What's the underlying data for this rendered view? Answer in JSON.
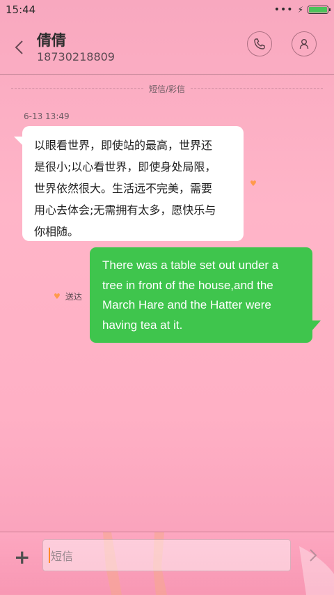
{
  "status_bar": {
    "time": "15:44",
    "dots": "•••",
    "battery_level": 1.0
  },
  "header": {
    "contact_name": "倩倩",
    "phone_number": "18730218809",
    "icons": {
      "back": "chevron-left-icon",
      "call": "phone-icon",
      "contact": "person-icon"
    }
  },
  "thread": {
    "channel_label": "短信/彩信",
    "timestamp": "6-13 13:49",
    "incoming": {
      "lines": [
        "以眼看世界，即使站的最高，世界还",
        "是很小;以心看世界，即使身处局限，",
        "世界依然很大。生活远不完美，需要",
        "用心去体会;无需拥有太多，愿快乐与",
        "你相随。"
      ]
    },
    "outgoing": {
      "lines": [
        "There was a table set out under a",
        "tree in front of the house,and the",
        "March Hare and the Hatter were",
        "having tea at it."
      ],
      "status": "送达"
    }
  },
  "composer": {
    "placeholder": "短信",
    "icons": {
      "add": "plus-icon",
      "send": "chevron-right-icon"
    }
  },
  "colors": {
    "accent_green": "#3fc54d",
    "status_heart": "#ff9a4c",
    "background_pink": "#ffb5c8"
  }
}
